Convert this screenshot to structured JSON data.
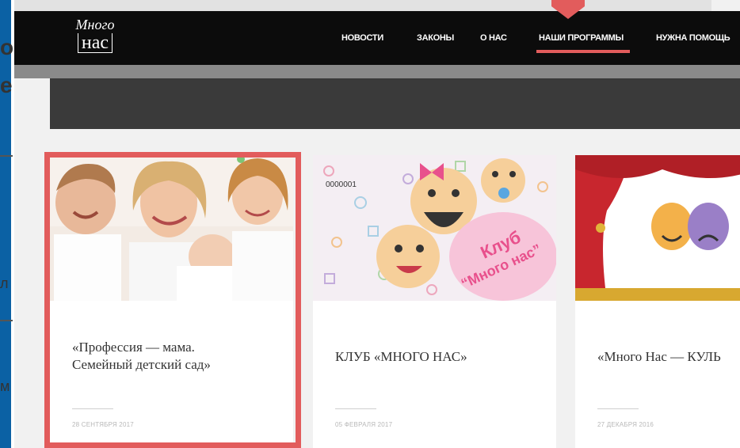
{
  "left_fragments": [
    "о",
    "е",
    "л",
    "м"
  ],
  "header": {
    "logo": {
      "line1": "Много",
      "line2": "нас"
    },
    "nav": [
      {
        "label": "НОВОСТИ"
      },
      {
        "label": "ЗАКОНЫ"
      },
      {
        "label": "О НАС"
      },
      {
        "label": "НАШИ ПРОГРАММЫ",
        "active": true
      },
      {
        "label": "НУЖНА ПОМОЩЬ"
      }
    ]
  },
  "cards": [
    {
      "title_line1": "«Профессия — мама.",
      "title_line2": "Семейный детский сад»",
      "date": "28 СЕНТЯБРЯ 2017",
      "highlighted": true
    },
    {
      "title_line1": "КЛУБ «МНОГО НАС»",
      "image_text_1": "Клуб",
      "image_text_2": "“Много нас”",
      "ticket": "0000001",
      "date": "05 ФЕВРАЛЯ 2017"
    },
    {
      "title_line1": "«Много Нас — КУЛЬ",
      "date": "27 ДЕКАБРЯ 2016"
    }
  ],
  "colors": {
    "accent": "#e25c5c",
    "header_bg": "#0c0c0c",
    "frame_blue": "#0b61a4"
  }
}
